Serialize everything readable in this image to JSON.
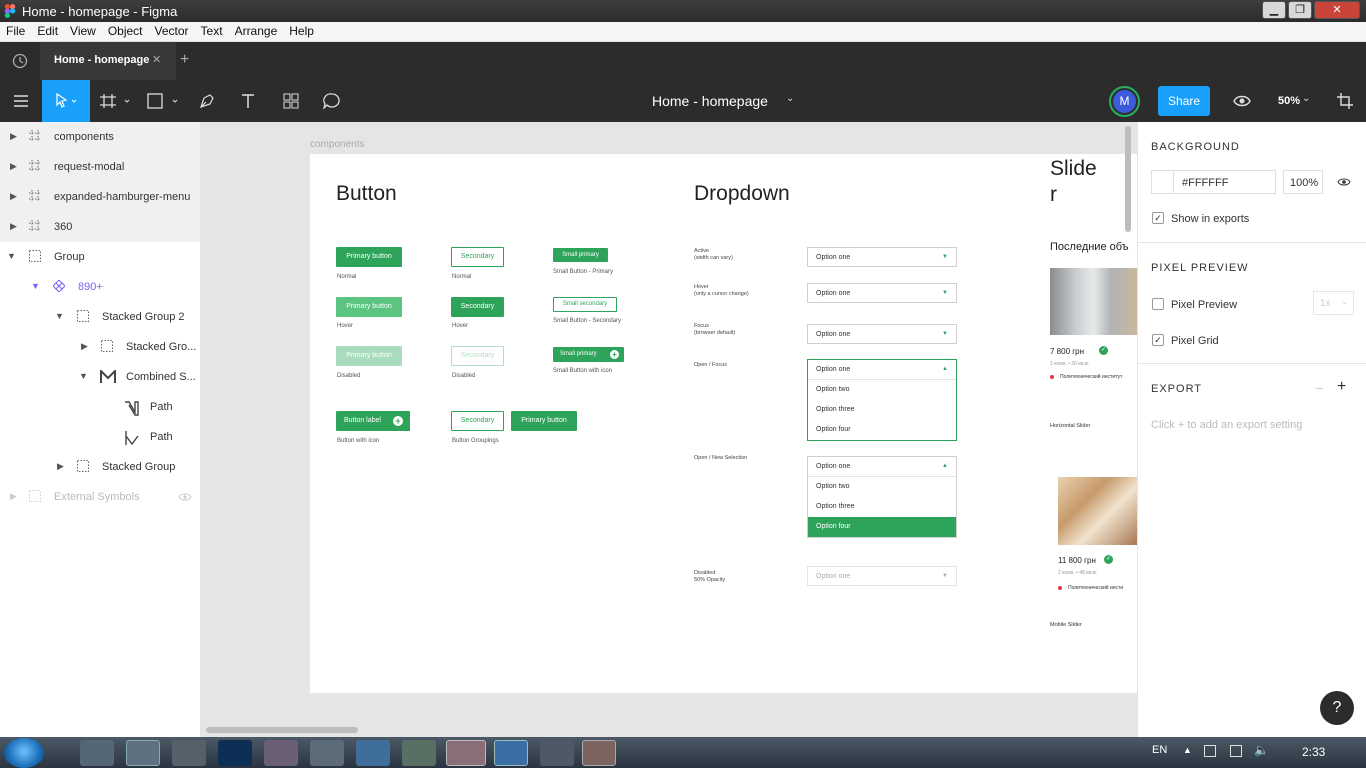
{
  "window": {
    "title": "Home - homepage - Figma",
    "minimize": "▁",
    "maximize": "❐",
    "close": "✕"
  },
  "menu": [
    "File",
    "Edit",
    "View",
    "Object",
    "Vector",
    "Text",
    "Arrange",
    "Help"
  ],
  "tabs": {
    "active": "Home - homepage",
    "close": "✕",
    "add": "+"
  },
  "toolbar": {
    "file_title": "Home - homepage",
    "avatar": "M",
    "share": "Share",
    "zoom": "50%"
  },
  "layers": [
    {
      "label": "components",
      "type": "frame"
    },
    {
      "label": "request-modal",
      "type": "frame"
    },
    {
      "label": "expanded-hamburger-menu",
      "type": "frame"
    },
    {
      "label": "360",
      "type": "frame"
    },
    {
      "label": "Group",
      "type": "group"
    },
    {
      "label": "890+",
      "type": "component"
    },
    {
      "label": "Stacked Group 2",
      "type": "group"
    },
    {
      "label": "Stacked Gro...",
      "type": "group"
    },
    {
      "label": "Combined S...",
      "type": "vector"
    },
    {
      "label": "Path",
      "type": "vector"
    },
    {
      "label": "Path",
      "type": "vector"
    },
    {
      "label": "Stacked Group",
      "type": "group"
    },
    {
      "label": "External Symbols",
      "type": "external"
    }
  ],
  "canvas": {
    "frame_label": "components",
    "button_title": "Button",
    "dropdown_title": "Dropdown",
    "slider_title": "Slide\nr",
    "buttons": {
      "primary": "Primary button",
      "secondary": "Secondary",
      "small_primary": "Small primary",
      "small_secondary": "Small secondary",
      "button_label": "Button label",
      "cap_normal": "Normal",
      "cap_hover": "Hover",
      "cap_disabled": "Disabled",
      "cap_small_primary": "Small Button - Primary",
      "cap_small_secondary": "Small Button - Secondary",
      "cap_small_icon": "Small Button with icon",
      "cap_with_icon": "Button with icon",
      "cap_groupings": "Button Groupings"
    },
    "dropdown": {
      "states": [
        "Active\n(width can vary)",
        "Hover\n(only a cursor change)",
        "Focus\n(browser default)",
        "Open / Focus",
        "Open / New Selection",
        "Disabled\n50% Opacity"
      ],
      "option_one": "Option one",
      "option_two": "Option two",
      "option_three": "Option three",
      "option_four": "Option four"
    },
    "slider": {
      "heading": "Последние объ",
      "price1": "7 800 грн",
      "meta1": "2 комн. • 30 кв.м.",
      "place1": "Политехнический институт",
      "h_slider": "Horizontal Slider",
      "price2": "11 800 грн",
      "meta2": "2 комн. • 48 кв.м.",
      "place2": "Политехнический инсти",
      "m_slider": "Mobile Slider"
    }
  },
  "properties": {
    "background_head": "BACKGROUND",
    "bg_color": "#FFFFFF",
    "bg_opacity": "100%",
    "show_exports": "Show in exports",
    "pixel_head": "PIXEL PREVIEW",
    "pixel_preview": "Pixel Preview",
    "pixel_scale": "1x",
    "pixel_grid": "Pixel Grid",
    "export_head": "EXPORT",
    "export_hint": "Click + to add an export setting",
    "minus": "−",
    "plus": "+",
    "help": "?"
  },
  "taskbar": {
    "lang": "EN",
    "time": "2:33"
  },
  "colors": {
    "figma_blue": "#18a0fb",
    "green": "#2ea45a",
    "avatar_ring": "#27ae60",
    "purple_component": "#7b61ff"
  }
}
